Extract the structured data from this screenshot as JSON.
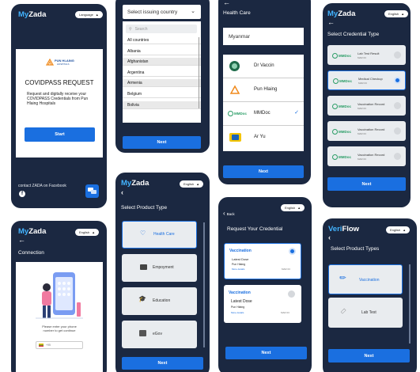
{
  "phone1": {
    "brand_my": "My",
    "brand_zada": "Zada",
    "lang": "Language",
    "hospital_name": "PUN HLAING",
    "hospital_sub": "HOSPITALS",
    "title": "COVIDPASS REQUEST",
    "description": "Request and digitally receive your COVIDPASS Credentials from Pun Hlaing Hospitals",
    "start": "Start",
    "contact": "contact ZADA on Facebook"
  },
  "phone2": {
    "select_label": "Select issuing country",
    "search_placeholder": "Search",
    "countries": [
      "All countries",
      "Albania",
      "Afghanistan",
      "Argentina",
      "Armenia",
      "Belgium",
      "Bolivia"
    ],
    "next": "Next"
  },
  "phone3": {
    "title": "Health Care",
    "country": "Myanmar",
    "providers": [
      "Dr Vaccin",
      "Pun Hlaing",
      "MMDoc",
      "Ar Yu"
    ],
    "next": "Next"
  },
  "phone4": {
    "brand_my": "My",
    "brand_zada": "Zada",
    "lang": "English",
    "title": "Select Credential Type",
    "credentials": [
      {
        "name": "Lab Test Result",
        "date": "MAR 03"
      },
      {
        "name": "Medical Checkup",
        "date": "MAR 03"
      },
      {
        "name": "Vaccination Record",
        "date": "MAR 03"
      },
      {
        "name": "Vaccination Record",
        "date": "MAR 03"
      },
      {
        "name": "Vaccination Record",
        "date": "MAR 03"
      }
    ],
    "issuer": "MMDoc",
    "next": "Next"
  },
  "phone5": {
    "brand_my": "My",
    "brand_zada": "Zada",
    "lang": "English",
    "title": "Connection",
    "prompt": "Please enter your phone number to get continue",
    "phone_placeholder": "+95"
  },
  "phone6": {
    "brand_my": "My",
    "brand_zada": "Zada",
    "lang": "English",
    "title": "Select Product Type",
    "products": [
      "Health Care",
      "Empoyment",
      "Education",
      "eGov"
    ],
    "next": "Next"
  },
  "phone7": {
    "back": "Back",
    "lang": "English",
    "title": "Request Your Credential",
    "items": [
      {
        "kind": "Vaccination",
        "dose": "Latest Dose",
        "issuer": "Pun Hlaing",
        "more": "More details",
        "date": "MAR 03"
      },
      {
        "kind": "Vaccination",
        "dose": "Latest Dose",
        "issuer": "Pun Hlaing",
        "more": "More details",
        "date": "MAR 03"
      }
    ],
    "next": "Next"
  },
  "phone8": {
    "brand_veri": "Veri",
    "brand_flow": "Flow",
    "lang": "English",
    "title": "Select Product Types",
    "products": [
      "Vaccination",
      "Lab Test"
    ],
    "next": "Next"
  },
  "colors": {
    "navy": "#1b2841",
    "accent": "#1a6fe0",
    "brand_blue": "#43b4ff"
  }
}
